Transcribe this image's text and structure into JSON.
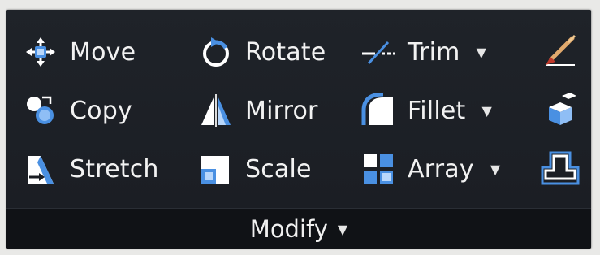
{
  "panel": {
    "title": "Modify",
    "title_dropdown_glyph": "▼"
  },
  "tools": {
    "move": {
      "label": "Move",
      "icon": "move-icon"
    },
    "copy": {
      "label": "Copy",
      "icon": "copy-icon"
    },
    "stretch": {
      "label": "Stretch",
      "icon": "stretch-icon"
    },
    "rotate": {
      "label": "Rotate",
      "icon": "rotate-icon"
    },
    "mirror": {
      "label": "Mirror",
      "icon": "mirror-icon"
    },
    "scale": {
      "label": "Scale",
      "icon": "scale-icon"
    },
    "trim": {
      "label": "Trim",
      "icon": "trim-icon",
      "dropdown": "▼"
    },
    "fillet": {
      "label": "Fillet",
      "icon": "fillet-icon",
      "dropdown": "▼"
    },
    "array": {
      "label": "Array",
      "icon": "array-icon",
      "dropdown": "▼"
    }
  },
  "side_tools": [
    "erase-icon",
    "explode-icon",
    "offset-icon"
  ],
  "colors": {
    "panel_bg": "#1f2329",
    "footer_bg": "#101216",
    "text": "#f2f2f2",
    "accent_blue": "#4a90e2",
    "icon_white": "#ffffff"
  }
}
